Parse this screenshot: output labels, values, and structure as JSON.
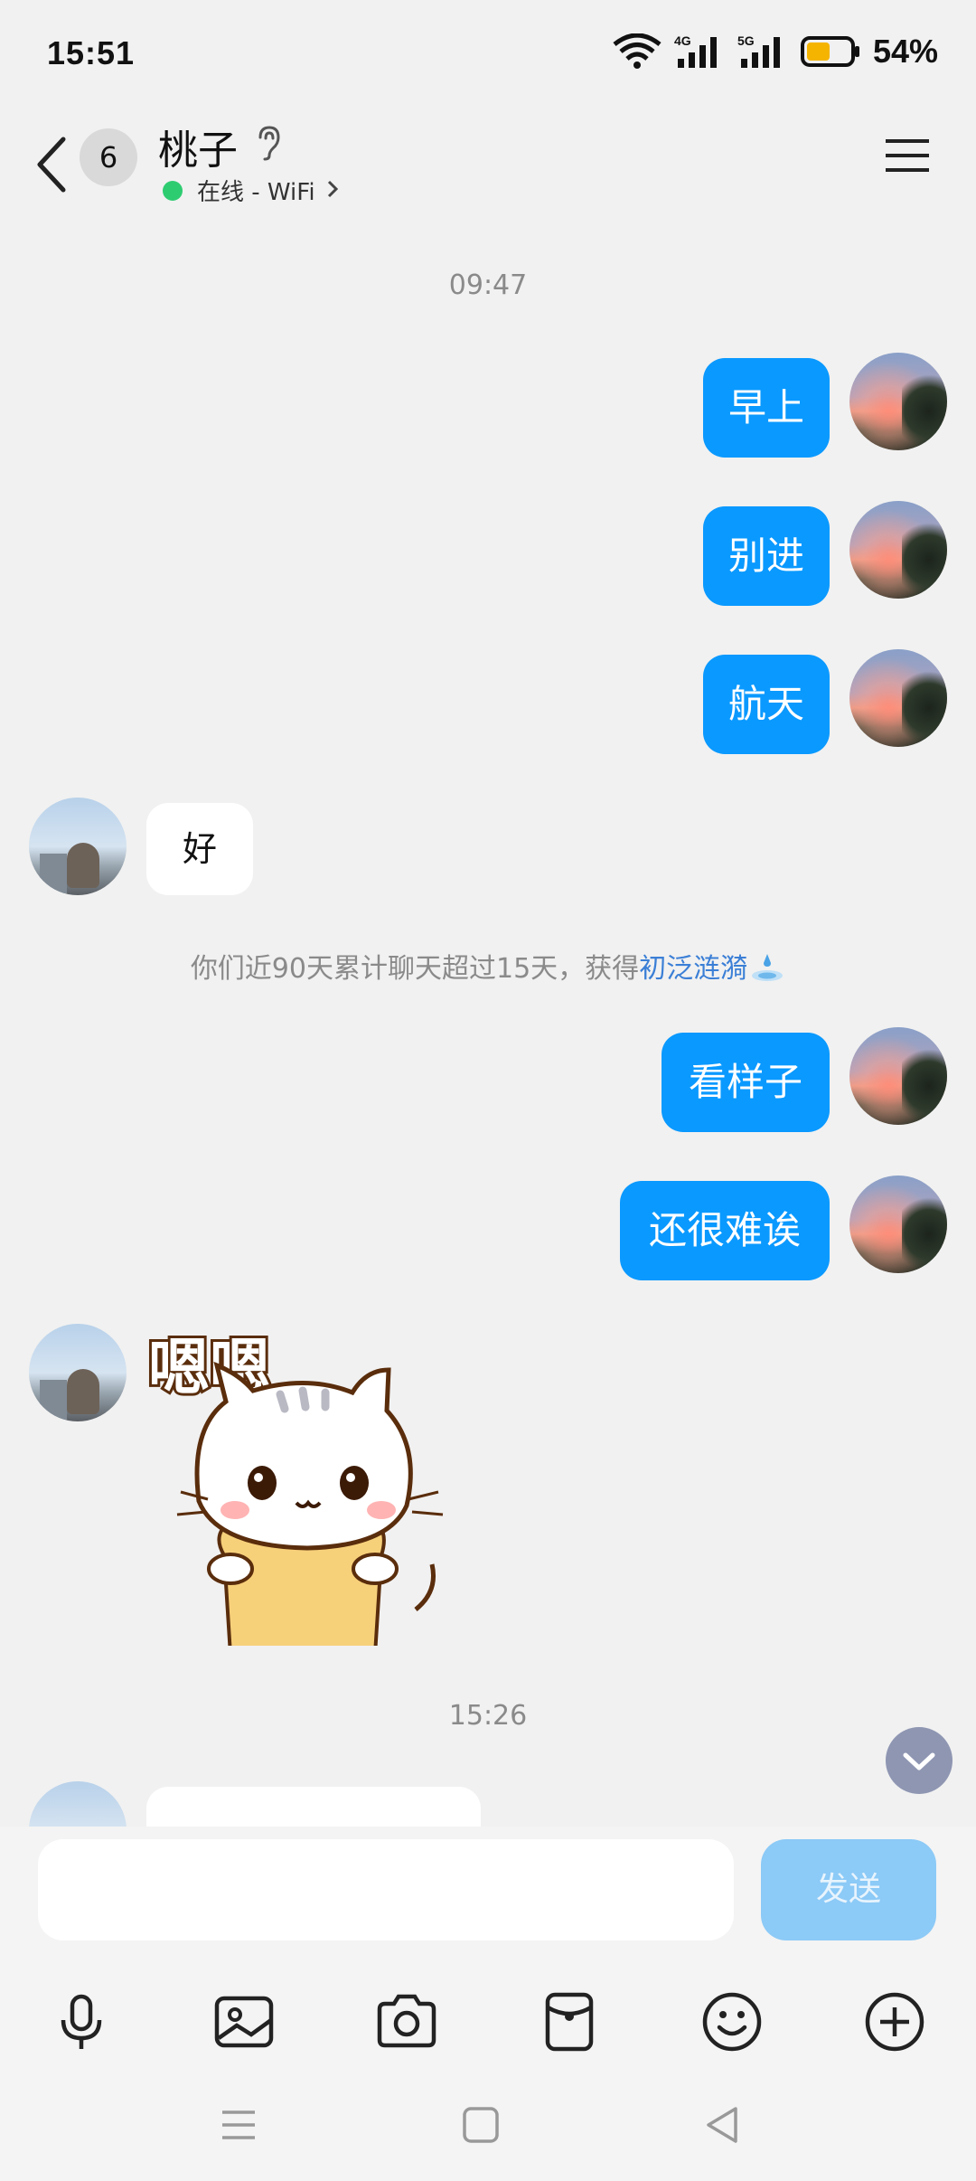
{
  "status_bar": {
    "time": "15:51",
    "network_4g": "4G",
    "network_5g": "5G",
    "battery_percent": "54%",
    "battery_level": 0.54
  },
  "header": {
    "unread_count": "6",
    "contact_name": "桃子",
    "online_status": "在线 - WiFi"
  },
  "chat": {
    "timestamp_1": "09:47",
    "messages": [
      {
        "from": "me",
        "text": "早上"
      },
      {
        "from": "me",
        "text": "别进"
      },
      {
        "from": "me",
        "text": "航天"
      },
      {
        "from": "them",
        "text": "好"
      },
      {
        "from": "me",
        "text": "看样子"
      },
      {
        "from": "me",
        "text": "还很难诶"
      }
    ],
    "system_note_prefix": "你们近90天累计聊天超过15天，获得",
    "system_note_highlight": "初泛涟漪",
    "sticker_text": "嗯嗯",
    "timestamp_2": "15:26"
  },
  "input": {
    "placeholder": "",
    "send_label": "发送"
  },
  "colors": {
    "my_bubble": "#0a99ff",
    "send_button": "#8ccaf7",
    "online_dot": "#2ecc71",
    "highlight_link": "#3b7fd6"
  },
  "icons": [
    "back-icon",
    "ear-icon",
    "menu-icon",
    "mic-icon",
    "image-icon",
    "camera-icon",
    "red-packet-icon",
    "emoji-icon",
    "plus-icon",
    "chevron-down-icon"
  ]
}
